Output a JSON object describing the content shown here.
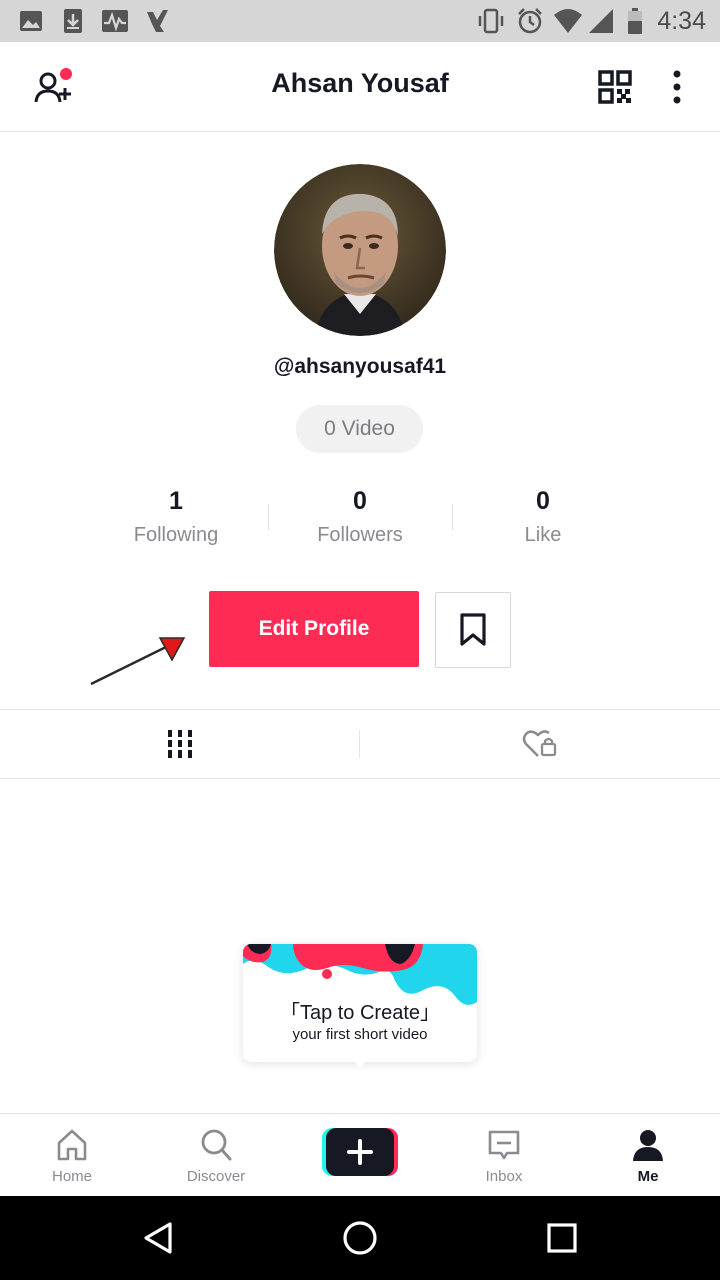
{
  "status_bar": {
    "time": "4:34",
    "left_icons": [
      "image-icon",
      "download-icon",
      "activity-icon",
      "check-icon"
    ],
    "right_icons": [
      "vibrate-icon",
      "alarm-icon",
      "wifi-icon",
      "signal-icon",
      "battery-icon"
    ]
  },
  "header": {
    "title": "Ahsan Yousaf",
    "left_icon": "add-friend-icon",
    "right_icons": [
      "qr-code-icon",
      "more-vertical-icon"
    ]
  },
  "profile": {
    "username": "@ahsanyousaf41",
    "video_pill": "0 Video",
    "stats": [
      {
        "value": "1",
        "label": "Following"
      },
      {
        "value": "0",
        "label": "Followers"
      },
      {
        "value": "0",
        "label": "Like"
      }
    ],
    "edit_button": "Edit Profile",
    "bookmark_icon": "bookmark-icon"
  },
  "tabs": [
    "grid-icon",
    "liked-private-icon"
  ],
  "create_prompt": {
    "title": "「Tap to Create」",
    "subtitle": "your first short video"
  },
  "bottom_nav": [
    {
      "label": "Home",
      "icon": "home-icon"
    },
    {
      "label": "Discover",
      "icon": "search-icon"
    },
    {
      "label": "",
      "icon": "create-plus-icon"
    },
    {
      "label": "Inbox",
      "icon": "inbox-icon"
    },
    {
      "label": "Me",
      "icon": "profile-icon",
      "active": true
    }
  ],
  "colors": {
    "accent": "#fe2c55",
    "cyan": "#25f4ee",
    "text": "#161823",
    "muted": "#8a8b91"
  }
}
